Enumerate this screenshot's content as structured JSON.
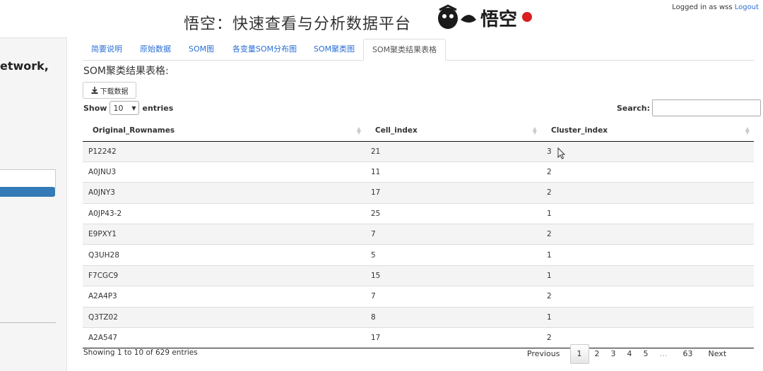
{
  "header": {
    "title": "悟空：快速查看与分析数据平台",
    "logo_text": "悟空",
    "login_text": "Logged in as wss",
    "logout_label": "Logout"
  },
  "sidebar": {
    "partial_text": "etwork,"
  },
  "tabs": [
    {
      "label": "简要说明"
    },
    {
      "label": "原始数据"
    },
    {
      "label": "SOM图"
    },
    {
      "label": "各变量SOM分布图"
    },
    {
      "label": "SOM聚类图"
    },
    {
      "label": "SOM聚类结果表格",
      "active": true
    }
  ],
  "section": {
    "title": "SOM聚类结果表格:"
  },
  "toolbar": {
    "download_label": "下载数据"
  },
  "length_menu": {
    "show_label": "Show",
    "value": "10",
    "entries_label": "entries"
  },
  "search": {
    "label": "Search:",
    "value": ""
  },
  "table": {
    "columns": [
      "Original_Rownames",
      "Cell_index",
      "Cluster_index"
    ],
    "rows": [
      [
        "P12242",
        "21",
        "3"
      ],
      [
        "A0JNU3",
        "11",
        "2"
      ],
      [
        "A0JNY3",
        "17",
        "2"
      ],
      [
        "A0JP43-2",
        "25",
        "1"
      ],
      [
        "E9PXY1",
        "7",
        "2"
      ],
      [
        "Q3UH28",
        "5",
        "1"
      ],
      [
        "F7CGC9",
        "15",
        "1"
      ],
      [
        "A2A4P3",
        "7",
        "2"
      ],
      [
        "Q3TZ02",
        "8",
        "1"
      ],
      [
        "A2A547",
        "17",
        "2"
      ]
    ]
  },
  "info": {
    "text": "Showing 1 to 10 of 629 entries"
  },
  "pagination": {
    "previous": "Previous",
    "pages": [
      "1",
      "2",
      "3",
      "4",
      "5",
      "…",
      "63"
    ],
    "current": "1",
    "next": "Next"
  }
}
